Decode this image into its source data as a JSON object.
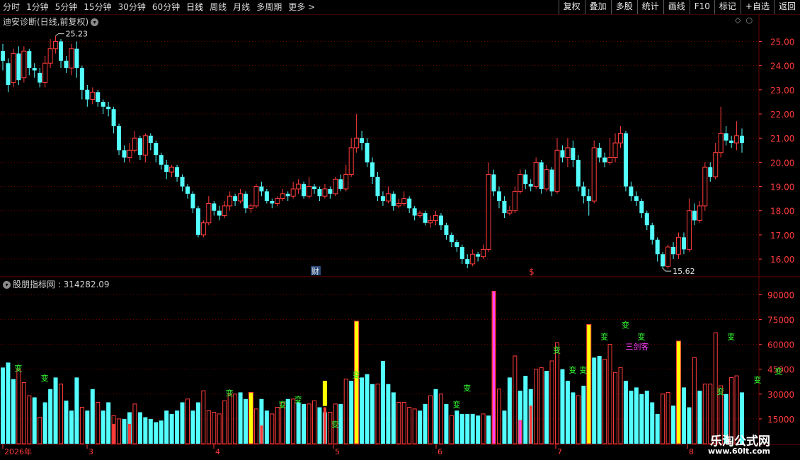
{
  "toolbar": {
    "periods": [
      "分时",
      "1分钟",
      "5分钟",
      "15分钟",
      "30分钟",
      "60分钟",
      "日线",
      "周线",
      "月线",
      "多周期",
      "更多"
    ],
    "active_period": "日线",
    "more_arrow": ">",
    "right_buttons": [
      "复权",
      "叠加",
      "多股",
      "统计",
      "画线",
      "F10",
      "标记",
      "+自选",
      "返回"
    ]
  },
  "main_panel": {
    "title": "迪安诊断(日线,前复权)",
    "high_label": "25.23",
    "low_label": "15.62",
    "markers": [
      "财",
      "$"
    ],
    "y_ticks": [
      "25.00",
      "24.00",
      "23.00",
      "22.00",
      "21.00",
      "20.00",
      "19.00",
      "18.00",
      "17.00",
      "16.00"
    ]
  },
  "indicator_panel": {
    "title": "股朋指标网 : 314282.09",
    "y_ticks": [
      "90000",
      "75000",
      "60000",
      "45000",
      "30000",
      "15000"
    ],
    "label_bian": "变",
    "label_sanjian": "三剑客"
  },
  "x_axis": {
    "labels": [
      "2026年",
      "3",
      "4",
      "5",
      "6",
      "7",
      "8"
    ]
  },
  "watermark": {
    "name": "乐淘公式网",
    "url": "www.60lt.com"
  },
  "colors": {
    "background": "#000000",
    "up": "#ff3c3c",
    "down": "#54ffff",
    "grid": "#6b0000",
    "axis_text": "#ff3c3c",
    "yellow": "#ffff00",
    "magenta": "#ff40ff",
    "label_green": "#33ff33"
  },
  "chart_data": {
    "type": "candlestick",
    "title": "迪安诊断(日线,前复权)",
    "ylim": [
      15.3,
      25.6
    ],
    "price_high": 25.23,
    "price_low": 15.62,
    "candles": [
      [
        24.6,
        24.2,
        24.9,
        23.8
      ],
      [
        24.1,
        23.2,
        24.3,
        22.9
      ],
      [
        23.3,
        24.5,
        24.7,
        23.1
      ],
      [
        24.5,
        23.4,
        24.8,
        23.2
      ],
      [
        23.5,
        24.6,
        24.8,
        23.3
      ],
      [
        24.6,
        23.9,
        24.7,
        23.6
      ],
      [
        23.9,
        23.8,
        24.1,
        23.5
      ],
      [
        23.7,
        23.3,
        23.9,
        23.1
      ],
      [
        23.3,
        24.1,
        24.4,
        23.1
      ],
      [
        24.1,
        24.7,
        25.1,
        23.9
      ],
      [
        24.7,
        25.0,
        25.23,
        24.5
      ],
      [
        25.0,
        24.2,
        25.1,
        23.9
      ],
      [
        24.2,
        23.9,
        24.4,
        23.7
      ],
      [
        23.9,
        24.7,
        24.9,
        23.6
      ],
      [
        24.7,
        23.9,
        25.0,
        23.5
      ],
      [
        23.9,
        23.0,
        24.0,
        22.6
      ],
      [
        23.0,
        22.6,
        23.2,
        22.3
      ],
      [
        22.6,
        22.9,
        23.1,
        22.4
      ],
      [
        22.9,
        22.5,
        23.0,
        22.3
      ],
      [
        22.5,
        22.3,
        22.6,
        22.0
      ],
      [
        22.3,
        22.2,
        22.5,
        21.9
      ],
      [
        22.2,
        21.5,
        22.3,
        21.2
      ],
      [
        21.5,
        20.5,
        21.6,
        20.3
      ],
      [
        20.5,
        20.2,
        20.7,
        20.0
      ],
      [
        20.2,
        20.5,
        20.8,
        20.0
      ],
      [
        20.5,
        21.0,
        21.3,
        20.4
      ],
      [
        21.0,
        20.3,
        21.1,
        20.1
      ],
      [
        20.3,
        21.1,
        21.2,
        20.0
      ],
      [
        21.1,
        20.8,
        21.2,
        20.5
      ],
      [
        20.8,
        20.3,
        20.9,
        20.0
      ],
      [
        20.3,
        19.9,
        20.4,
        19.7
      ],
      [
        19.9,
        19.6,
        20.1,
        19.3
      ],
      [
        19.6,
        19.8,
        19.9,
        19.4
      ],
      [
        19.8,
        19.4,
        19.9,
        19.2
      ],
      [
        19.4,
        19.0,
        19.5,
        18.8
      ],
      [
        19.0,
        18.7,
        19.1,
        18.5
      ],
      [
        18.7,
        18.1,
        18.8,
        17.9
      ],
      [
        18.1,
        17.0,
        18.2,
        16.9
      ],
      [
        17.0,
        17.5,
        17.6,
        16.9
      ],
      [
        17.5,
        18.3,
        18.6,
        17.4
      ],
      [
        18.3,
        18.0,
        18.4,
        17.8
      ],
      [
        18.0,
        17.8,
        18.2,
        17.6
      ],
      [
        17.8,
        18.2,
        18.4,
        17.7
      ],
      [
        18.2,
        18.6,
        18.8,
        18.0
      ],
      [
        18.6,
        18.4,
        18.7,
        18.2
      ],
      [
        18.4,
        18.7,
        18.9,
        18.3
      ],
      [
        18.7,
        18.1,
        18.8,
        17.9
      ],
      [
        18.1,
        18.2,
        18.3,
        17.9
      ],
      [
        18.2,
        19.0,
        19.1,
        18.1
      ],
      [
        19.0,
        18.8,
        19.2,
        18.6
      ],
      [
        18.8,
        18.4,
        18.9,
        18.3
      ],
      [
        18.4,
        18.3,
        18.5,
        18.1
      ],
      [
        18.3,
        18.5,
        18.6,
        18.2
      ],
      [
        18.5,
        18.7,
        18.9,
        18.4
      ],
      [
        18.7,
        18.6,
        18.8,
        18.4
      ],
      [
        18.6,
        18.9,
        19.2,
        18.5
      ],
      [
        18.9,
        19.1,
        19.3,
        18.7
      ],
      [
        19.1,
        18.6,
        19.2,
        18.5
      ],
      [
        18.6,
        19.0,
        19.4,
        18.5
      ],
      [
        19.0,
        18.9,
        19.1,
        18.7
      ],
      [
        18.9,
        18.6,
        19.0,
        18.4
      ],
      [
        18.6,
        18.9,
        19.1,
        18.5
      ],
      [
        18.9,
        18.7,
        19.0,
        18.5
      ],
      [
        18.7,
        19.3,
        19.4,
        18.6
      ],
      [
        19.3,
        18.9,
        19.5,
        18.8
      ],
      [
        18.9,
        19.5,
        19.9,
        18.8
      ],
      [
        19.5,
        20.6,
        21.0,
        19.4
      ],
      [
        20.6,
        21.0,
        22.0,
        20.4
      ],
      [
        21.0,
        20.8,
        21.3,
        20.5
      ],
      [
        20.8,
        20.0,
        21.0,
        19.8
      ],
      [
        20.0,
        19.4,
        20.2,
        19.1
      ],
      [
        19.4,
        18.6,
        19.6,
        18.4
      ],
      [
        18.6,
        18.4,
        18.8,
        18.2
      ],
      [
        18.4,
        18.7,
        19.0,
        18.3
      ],
      [
        18.7,
        18.2,
        18.8,
        18.0
      ],
      [
        18.2,
        18.3,
        18.5,
        18.1
      ],
      [
        18.3,
        18.5,
        18.8,
        18.2
      ],
      [
        18.5,
        18.1,
        18.6,
        17.9
      ],
      [
        18.1,
        17.8,
        18.2,
        17.6
      ],
      [
        17.8,
        17.9,
        18.0,
        17.7
      ],
      [
        17.9,
        17.5,
        18.0,
        17.4
      ],
      [
        17.5,
        17.6,
        17.8,
        17.3
      ],
      [
        17.6,
        17.8,
        18.0,
        17.4
      ],
      [
        17.8,
        17.4,
        17.9,
        17.2
      ],
      [
        17.4,
        17.0,
        17.5,
        16.8
      ],
      [
        17.0,
        16.7,
        17.1,
        16.5
      ],
      [
        16.7,
        16.5,
        16.8,
        16.3
      ],
      [
        16.5,
        16.0,
        16.6,
        15.8
      ],
      [
        16.0,
        15.8,
        16.2,
        15.62
      ],
      [
        15.8,
        16.2,
        16.4,
        15.7
      ],
      [
        16.2,
        16.1,
        16.3,
        15.9
      ],
      [
        16.1,
        16.4,
        16.6,
        16.0
      ],
      [
        16.4,
        19.5,
        20.0,
        16.3
      ],
      [
        19.5,
        18.8,
        19.7,
        18.6
      ],
      [
        18.8,
        18.4,
        19.0,
        18.1
      ],
      [
        18.4,
        17.9,
        18.6,
        17.7
      ],
      [
        17.9,
        18.0,
        18.2,
        17.8
      ],
      [
        18.0,
        18.8,
        19.0,
        17.9
      ],
      [
        18.8,
        19.5,
        19.7,
        18.7
      ],
      [
        19.5,
        19.1,
        19.7,
        18.9
      ],
      [
        19.1,
        19.0,
        19.3,
        18.8
      ],
      [
        19.0,
        20.0,
        20.2,
        18.9
      ],
      [
        20.0,
        18.9,
        20.1,
        18.7
      ],
      [
        18.9,
        19.7,
        19.9,
        18.8
      ],
      [
        19.7,
        18.8,
        19.8,
        18.6
      ],
      [
        18.8,
        20.5,
        21.0,
        18.7
      ],
      [
        20.5,
        20.2,
        20.7,
        20.0
      ],
      [
        20.2,
        20.6,
        21.0,
        19.8
      ],
      [
        20.6,
        20.1,
        20.9,
        19.8
      ],
      [
        20.1,
        19.0,
        20.3,
        18.8
      ],
      [
        19.0,
        18.6,
        19.2,
        18.3
      ],
      [
        18.6,
        18.4,
        18.9,
        17.8
      ],
      [
        18.4,
        20.6,
        20.9,
        18.3
      ],
      [
        20.6,
        20.2,
        20.8,
        20.0
      ],
      [
        20.2,
        20.0,
        20.4,
        19.8
      ],
      [
        20.0,
        20.2,
        21.0,
        19.9
      ],
      [
        20.2,
        20.8,
        21.2,
        20.0
      ],
      [
        20.8,
        21.2,
        21.5,
        20.6
      ],
      [
        21.2,
        19.0,
        21.3,
        18.8
      ],
      [
        19.0,
        18.6,
        19.2,
        18.4
      ],
      [
        18.6,
        18.4,
        18.8,
        18.2
      ],
      [
        18.4,
        17.9,
        18.5,
        17.7
      ],
      [
        17.9,
        17.4,
        18.0,
        17.2
      ],
      [
        17.4,
        16.8,
        17.5,
        16.6
      ],
      [
        16.8,
        16.2,
        16.9,
        15.9
      ],
      [
        16.2,
        15.7,
        16.3,
        15.6
      ],
      [
        15.7,
        16.5,
        16.6,
        15.6
      ],
      [
        16.5,
        16.2,
        16.7,
        16.0
      ],
      [
        16.2,
        16.9,
        17.1,
        16.0
      ],
      [
        16.9,
        16.4,
        17.1,
        16.2
      ],
      [
        16.4,
        18.0,
        18.5,
        16.3
      ],
      [
        18.0,
        17.6,
        18.3,
        17.4
      ],
      [
        17.6,
        18.2,
        18.4,
        17.5
      ],
      [
        18.2,
        19.8,
        20.0,
        18.0
      ],
      [
        19.8,
        19.4,
        20.0,
        19.2
      ],
      [
        19.4,
        20.4,
        20.8,
        19.3
      ],
      [
        20.4,
        21.2,
        22.3,
        20.2
      ],
      [
        21.2,
        20.9,
        21.5,
        20.7
      ],
      [
        20.9,
        20.8,
        21.1,
        20.6
      ],
      [
        20.8,
        21.1,
        21.7,
        20.5
      ],
      [
        21.1,
        20.8,
        21.4,
        20.4
      ]
    ],
    "volume": [
      [
        46000,
        "down"
      ],
      [
        49000,
        "down"
      ],
      [
        39000,
        "down"
      ],
      [
        45000,
        "up"
      ],
      [
        37000,
        "up"
      ],
      [
        29000,
        "up"
      ],
      [
        28000,
        "down"
      ],
      [
        16000,
        "up"
      ],
      [
        25000,
        "down"
      ],
      [
        33000,
        "down"
      ],
      [
        40000,
        "down"
      ],
      [
        36000,
        "up"
      ],
      [
        26000,
        "down"
      ],
      [
        20000,
        "down"
      ],
      [
        40000,
        "down"
      ],
      [
        22000,
        "up"
      ],
      [
        20000,
        "down"
      ],
      [
        33000,
        "down"
      ],
      [
        25000,
        "up"
      ],
      [
        20000,
        "down"
      ],
      [
        25000,
        "down"
      ],
      [
        17000,
        "up"
      ],
      [
        15000,
        "up"
      ],
      [
        15000,
        "down"
      ],
      [
        19000,
        "down"
      ],
      [
        24000,
        "up"
      ],
      [
        19000,
        "down"
      ],
      [
        16000,
        "down"
      ],
      [
        15000,
        "down"
      ],
      [
        13000,
        "down"
      ],
      [
        14000,
        "down"
      ],
      [
        20000,
        "down"
      ],
      [
        18000,
        "down"
      ],
      [
        20000,
        "down"
      ],
      [
        25000,
        "down"
      ],
      [
        27000,
        "up"
      ],
      [
        20000,
        "down"
      ],
      [
        25000,
        "down"
      ],
      [
        32000,
        "up"
      ],
      [
        20000,
        "up"
      ],
      [
        19000,
        "up"
      ],
      [
        18000,
        "up"
      ],
      [
        26000,
        "up"
      ],
      [
        30000,
        "up"
      ],
      [
        30000,
        "up"
      ],
      [
        31000,
        "down"
      ],
      [
        27000,
        "down"
      ],
      [
        19000,
        "up"
      ],
      [
        21000,
        "up"
      ],
      [
        27000,
        "down"
      ],
      [
        20000,
        "down"
      ],
      [
        18000,
        "up"
      ],
      [
        22000,
        "up"
      ],
      [
        25000,
        "up"
      ],
      [
        27000,
        "down"
      ],
      [
        27000,
        "up"
      ],
      [
        25000,
        "down"
      ],
      [
        24000,
        "down"
      ],
      [
        24000,
        "up"
      ],
      [
        26000,
        "up"
      ],
      [
        22000,
        "down"
      ],
      [
        19000,
        "down"
      ],
      [
        19000,
        "up"
      ],
      [
        24000,
        "up"
      ],
      [
        24000,
        "down"
      ],
      [
        39000,
        "up"
      ],
      [
        38000,
        "down"
      ],
      [
        72000,
        "up"
      ],
      [
        40000,
        "down"
      ],
      [
        42000,
        "down"
      ],
      [
        36000,
        "down"
      ],
      [
        36000,
        "up"
      ],
      [
        50000,
        "down"
      ],
      [
        36000,
        "down"
      ],
      [
        31000,
        "down"
      ],
      [
        25000,
        "up"
      ],
      [
        25000,
        "up"
      ],
      [
        22000,
        "up"
      ],
      [
        21000,
        "up"
      ],
      [
        20000,
        "down"
      ],
      [
        24000,
        "down"
      ],
      [
        29000,
        "up"
      ],
      [
        33000,
        "down"
      ],
      [
        30000,
        "up"
      ],
      [
        24000,
        "down"
      ],
      [
        17000,
        "up"
      ],
      [
        20000,
        "down"
      ],
      [
        18000,
        "down"
      ],
      [
        18000,
        "down"
      ],
      [
        18000,
        "down"
      ],
      [
        17000,
        "down"
      ],
      [
        18000,
        "up"
      ],
      [
        17000,
        "down"
      ],
      [
        92000,
        "up"
      ],
      [
        33000,
        "up"
      ],
      [
        20000,
        "down"
      ],
      [
        40000,
        "down"
      ],
      [
        53000,
        "up"
      ],
      [
        32000,
        "down"
      ],
      [
        41000,
        "down"
      ],
      [
        33000,
        "down"
      ],
      [
        45000,
        "up"
      ],
      [
        46000,
        "up"
      ],
      [
        44000,
        "down"
      ],
      [
        50000,
        "up"
      ],
      [
        61000,
        "up"
      ],
      [
        45000,
        "down"
      ],
      [
        38000,
        "down"
      ],
      [
        31000,
        "down"
      ],
      [
        29000,
        "up"
      ],
      [
        35000,
        "down"
      ],
      [
        72000,
        "up"
      ],
      [
        52000,
        "down"
      ],
      [
        53000,
        "down"
      ],
      [
        51000,
        "up"
      ],
      [
        60000,
        "up"
      ],
      [
        43000,
        "up"
      ],
      [
        46000,
        "up"
      ],
      [
        38000,
        "down"
      ],
      [
        32000,
        "down"
      ],
      [
        34000,
        "down"
      ],
      [
        30000,
        "down"
      ],
      [
        32000,
        "down"
      ],
      [
        25000,
        "down"
      ],
      [
        18000,
        "down"
      ],
      [
        30000,
        "up"
      ],
      [
        31000,
        "up"
      ],
      [
        23000,
        "down"
      ],
      [
        60000,
        "up"
      ],
      [
        34000,
        "down"
      ],
      [
        22000,
        "down"
      ],
      [
        52000,
        "up"
      ],
      [
        32000,
        "down"
      ],
      [
        36000,
        "up"
      ],
      [
        36000,
        "up"
      ],
      [
        67000,
        "up"
      ],
      [
        35000,
        "up"
      ],
      [
        30000,
        "down"
      ],
      [
        40000,
        "up"
      ],
      [
        41000,
        "up"
      ],
      [
        31000,
        "down"
      ]
    ],
    "yellow_bars": [
      [
        47,
        31000
      ],
      [
        67,
        74000
      ],
      [
        111,
        72000
      ],
      [
        128,
        62000
      ]
    ],
    "yellow_small": [
      [
        61,
        38000
      ]
    ],
    "red_fill": [
      [
        21,
        12000
      ],
      [
        24,
        12000
      ],
      [
        49,
        11000
      ],
      [
        61,
        22000
      ],
      [
        100,
        23000
      ],
      [
        93,
        40000
      ]
    ],
    "magenta_bars": [
      [
        93,
        92000
      ],
      [
        98,
        14000
      ]
    ],
    "bian_labels": [
      [
        3,
        44000
      ],
      [
        8,
        38000
      ],
      [
        43,
        29000
      ],
      [
        53,
        22000
      ],
      [
        56,
        25000
      ],
      [
        63,
        10000
      ],
      [
        67,
        40000
      ],
      [
        86,
        22000
      ],
      [
        88,
        32000
      ],
      [
        105,
        55000
      ],
      [
        108,
        43000
      ],
      [
        110,
        43000
      ],
      [
        114,
        63000
      ],
      [
        118,
        70000
      ],
      [
        121,
        63000
      ],
      [
        136,
        30000
      ],
      [
        138,
        63000
      ],
      [
        143,
        37000
      ],
      [
        147,
        42000
      ]
    ],
    "sanjian_index": 119,
    "sanjian_value": 57000,
    "volume_ylim": [
      0,
      97000
    ]
  }
}
